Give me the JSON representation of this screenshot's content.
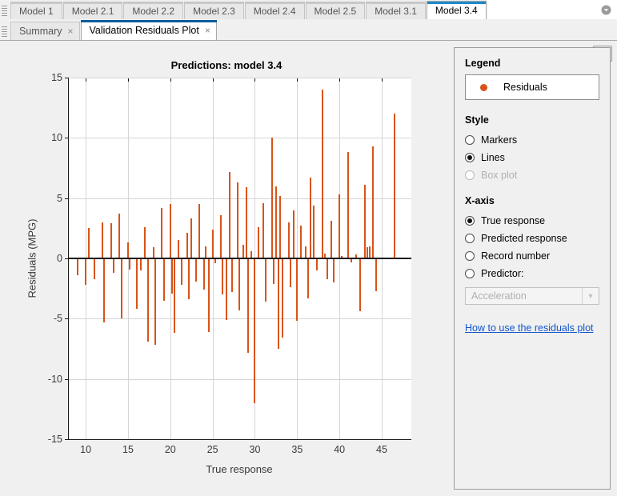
{
  "model_tabs": [
    {
      "label": "Model 1",
      "selected": false
    },
    {
      "label": "Model 2.1",
      "selected": false
    },
    {
      "label": "Model 2.2",
      "selected": false
    },
    {
      "label": "Model 2.3",
      "selected": false
    },
    {
      "label": "Model 2.4",
      "selected": false
    },
    {
      "label": "Model 2.5",
      "selected": false
    },
    {
      "label": "Model 3.1",
      "selected": false
    },
    {
      "label": "Model 3.4",
      "selected": true
    }
  ],
  "model_tabs_overflow_icon": "chevron-down-icon",
  "doc_tabs": [
    {
      "label": "Summary",
      "selected": false,
      "close": "×"
    },
    {
      "label": "Validation Residuals Plot",
      "selected": true,
      "close": "×"
    }
  ],
  "undock_icon": "undock-arrow-icon",
  "panel": {
    "legend": {
      "title": "Legend",
      "entries": [
        {
          "label": "Residuals",
          "color": "#d95319",
          "marker": "circle"
        }
      ]
    },
    "style": {
      "title": "Style",
      "options": [
        {
          "label": "Markers",
          "selected": false,
          "disabled": false
        },
        {
          "label": "Lines",
          "selected": true,
          "disabled": false
        },
        {
          "label": "Box plot",
          "selected": false,
          "disabled": true
        }
      ]
    },
    "xaxis": {
      "title": "X-axis",
      "options": [
        {
          "label": "True response",
          "selected": true,
          "disabled": false
        },
        {
          "label": "Predicted response",
          "selected": false,
          "disabled": false
        },
        {
          "label": "Record number",
          "selected": false,
          "disabled": false
        },
        {
          "label": "Predictor:",
          "selected": false,
          "disabled": false
        }
      ],
      "predictor_select": {
        "value": "Acceleration",
        "disabled": true,
        "arrow": "▼"
      }
    },
    "help_link": "How to use the residuals plot"
  },
  "chart_data": {
    "type": "bar",
    "title": "Predictions: model 3.4",
    "xlabel": "True response",
    "ylabel": "Residuals (MPG)",
    "xlim": [
      8,
      48.5
    ],
    "ylim": [
      -15,
      15
    ],
    "xticks": [
      10,
      15,
      20,
      25,
      30,
      35,
      40,
      45
    ],
    "yticks": [
      15,
      10,
      5,
      0,
      -5,
      -10,
      -15
    ],
    "grid": true,
    "legend_position": "external-right",
    "series_name": "Residuals",
    "series_color": "#d95319",
    "zero_line": 0,
    "points": [
      [
        9.0,
        -1.4
      ],
      [
        10.0,
        -2.2
      ],
      [
        10.4,
        2.5
      ],
      [
        11.0,
        -1.7
      ],
      [
        12.0,
        3.0
      ],
      [
        12.2,
        -5.3
      ],
      [
        13.0,
        2.9
      ],
      [
        13.3,
        -1.2
      ],
      [
        14.0,
        3.7
      ],
      [
        14.2,
        -5.0
      ],
      [
        15.0,
        1.3
      ],
      [
        15.2,
        -0.9
      ],
      [
        16.0,
        -4.2
      ],
      [
        16.5,
        -1.0
      ],
      [
        17.0,
        2.6
      ],
      [
        17.4,
        -6.9
      ],
      [
        18.0,
        0.9
      ],
      [
        18.2,
        -7.2
      ],
      [
        19.0,
        4.2
      ],
      [
        19.3,
        -3.5
      ],
      [
        20.0,
        4.5
      ],
      [
        20.2,
        -2.9
      ],
      [
        20.5,
        -6.2
      ],
      [
        21.0,
        1.5
      ],
      [
        21.3,
        -2.2
      ],
      [
        22.0,
        2.1
      ],
      [
        22.2,
        -3.4
      ],
      [
        22.5,
        3.3
      ],
      [
        23.0,
        -1.9
      ],
      [
        23.4,
        4.5
      ],
      [
        24.0,
        -2.6
      ],
      [
        24.2,
        1.0
      ],
      [
        24.6,
        -6.1
      ],
      [
        25.0,
        2.4
      ],
      [
        25.3,
        -0.4
      ],
      [
        26.0,
        3.6
      ],
      [
        26.2,
        -3.0
      ],
      [
        26.6,
        -5.1
      ],
      [
        27.0,
        7.2
      ],
      [
        27.3,
        -2.8
      ],
      [
        28.0,
        6.3
      ],
      [
        28.2,
        -4.3
      ],
      [
        28.6,
        1.1
      ],
      [
        29.0,
        5.9
      ],
      [
        29.2,
        -7.8
      ],
      [
        29.6,
        0.6
      ],
      [
        30.0,
        -12.0
      ],
      [
        30.4,
        2.6
      ],
      [
        31.0,
        4.6
      ],
      [
        31.3,
        -3.6
      ],
      [
        32.0,
        10.0
      ],
      [
        32.2,
        -2.1
      ],
      [
        32.5,
        6.0
      ],
      [
        32.8,
        -7.5
      ],
      [
        33.0,
        5.2
      ],
      [
        33.3,
        -6.6
      ],
      [
        34.0,
        3.0
      ],
      [
        34.2,
        -2.4
      ],
      [
        34.6,
        4.0
      ],
      [
        35.0,
        -5.2
      ],
      [
        35.4,
        2.7
      ],
      [
        36.0,
        1.0
      ],
      [
        36.3,
        -3.3
      ],
      [
        36.6,
        6.7
      ],
      [
        37.0,
        4.4
      ],
      [
        37.3,
        -1.0
      ],
      [
        38.0,
        14.0
      ],
      [
        38.3,
        0.4
      ],
      [
        38.6,
        -1.7
      ],
      [
        39.0,
        3.1
      ],
      [
        39.3,
        -2.0
      ],
      [
        40.0,
        5.3
      ],
      [
        40.3,
        0.2
      ],
      [
        41.0,
        8.8
      ],
      [
        41.4,
        -0.3
      ],
      [
        42.0,
        0.3
      ],
      [
        42.4,
        -4.4
      ],
      [
        43.0,
        6.1
      ],
      [
        43.3,
        0.9
      ],
      [
        43.6,
        1.0
      ],
      [
        44.0,
        9.3
      ],
      [
        44.3,
        -2.7
      ],
      [
        46.5,
        12.0
      ]
    ]
  }
}
